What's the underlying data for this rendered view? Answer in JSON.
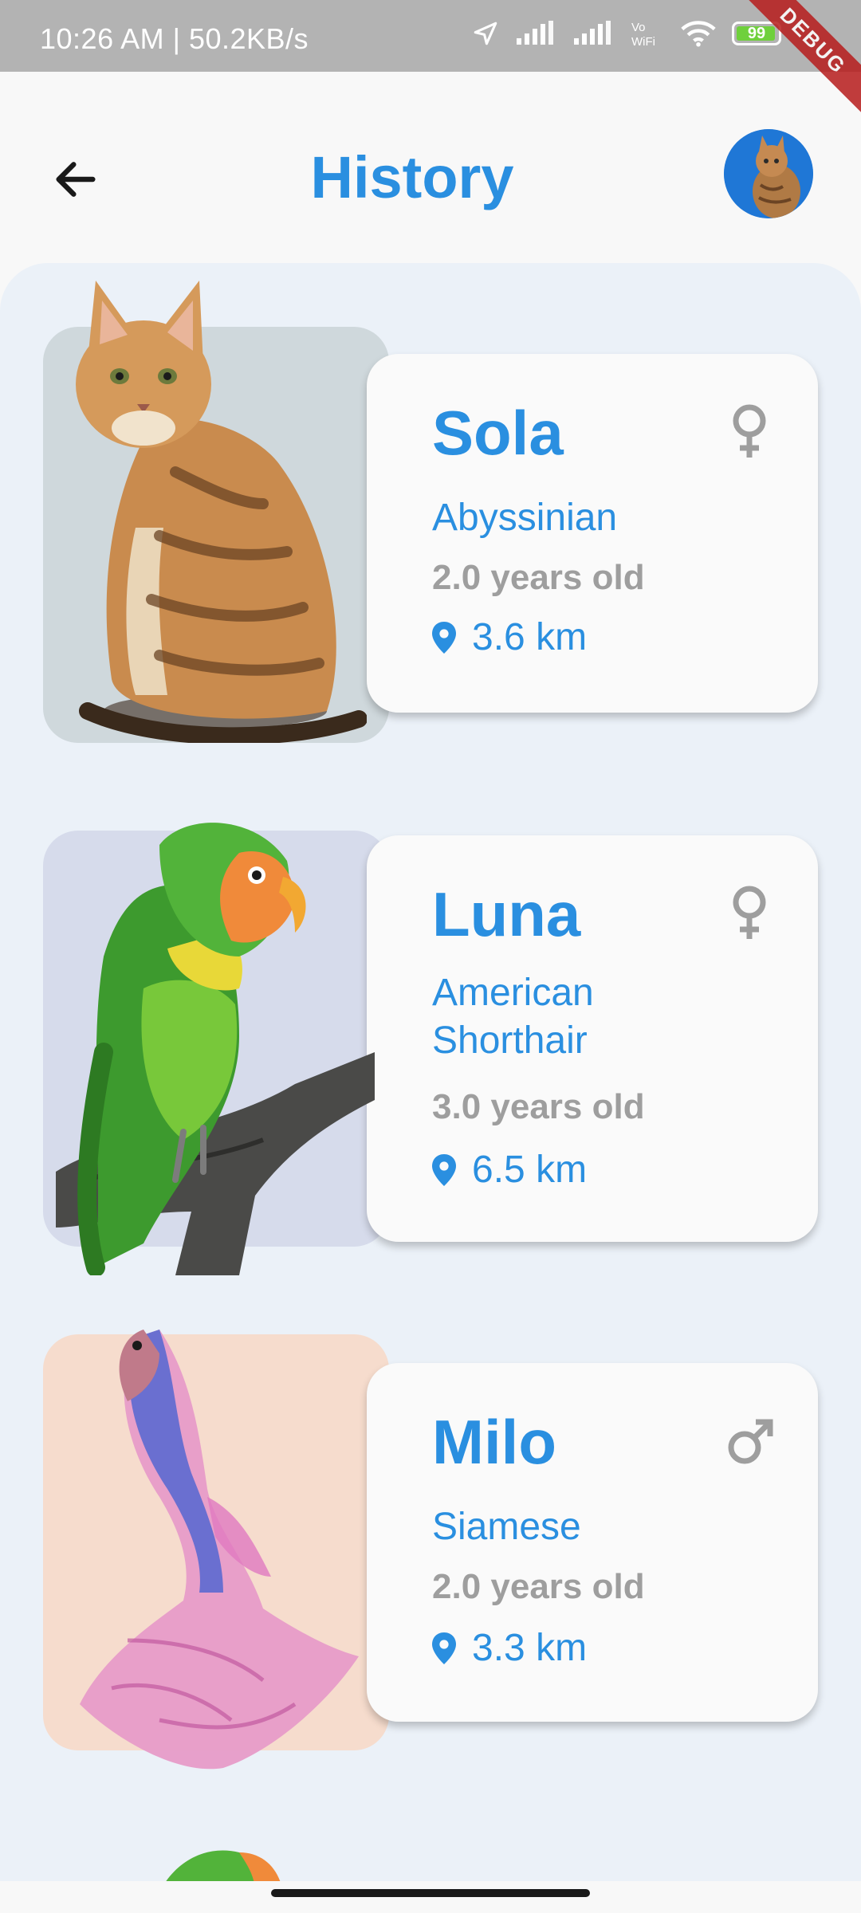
{
  "status_bar": {
    "time": "10:26 AM | 50.2KB/s",
    "battery": "99",
    "debug": "DEBUG"
  },
  "header": {
    "title": "History"
  },
  "pets": [
    {
      "name": "Sola",
      "breed": "Abyssinian",
      "age": "2.0 years old",
      "distance": "3.6 km",
      "gender": "female",
      "gender_icon": "female-icon",
      "bg": "#cfd8dc"
    },
    {
      "name": "Luna",
      "breed": "American Shorthair",
      "age": "3.0 years old",
      "distance": "6.5 km",
      "gender": "female",
      "gender_icon": "female-icon",
      "bg": "#d6dbeb"
    },
    {
      "name": "Milo",
      "breed": "Siamese",
      "age": "2.0 years old",
      "distance": "3.3 km",
      "gender": "male",
      "gender_icon": "male-icon",
      "bg": "#f6dccd"
    }
  ],
  "colors": {
    "accent": "#2a8fe0",
    "muted": "#9e9e9e",
    "panel": "#ebf1f8"
  }
}
